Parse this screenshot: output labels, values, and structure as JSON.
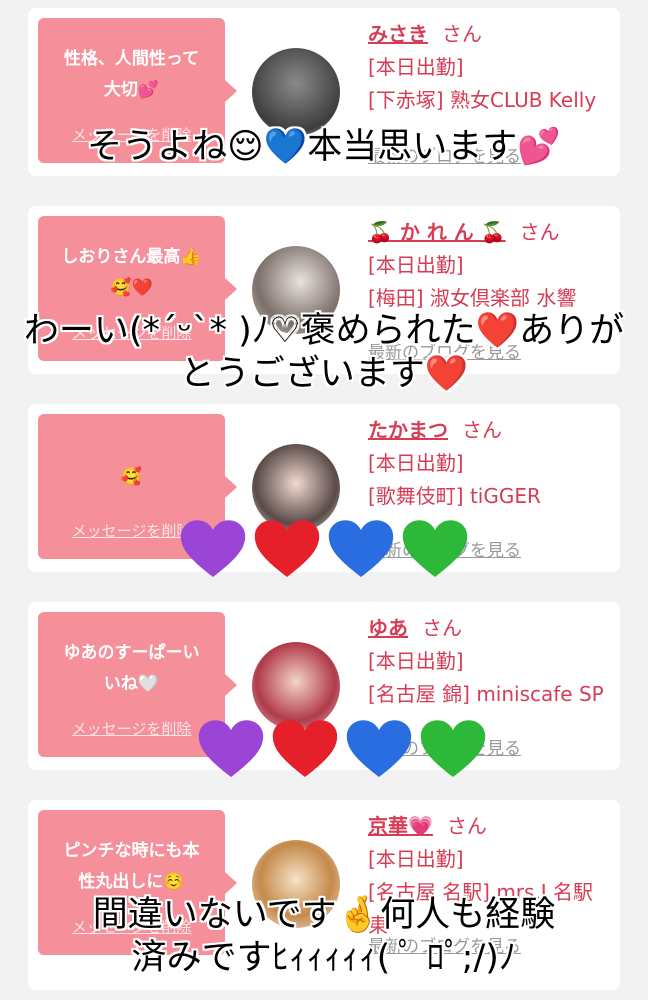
{
  "cards": [
    {
      "message": "性格、人間性って\n大切💕",
      "delete_label": "メッセージを削除",
      "name": "みさき",
      "san": "さん",
      "info": "[本日出勤]\n[下赤塚] 熟女CLUB Kelly",
      "blog_label": "最新のブログを見る"
    },
    {
      "message": "しおりさん最高👍\n🥰❤️",
      "delete_label": "メッセージを削除",
      "name": "🍒 か れ ん 🍒",
      "san": "さん",
      "info": "[本日出勤]\n[梅田] 淑女倶楽部 水響",
      "blog_label": "最新のブログを見る"
    },
    {
      "message": "🥰",
      "delete_label": "メッセージを削除",
      "name": "たかまつ",
      "san": "さん",
      "info": "[本日出勤]\n[歌舞伎町] tiGGER",
      "blog_label": "最新のブログを見る"
    },
    {
      "message": "ゆあのすーぱーい\nいね🤍",
      "delete_label": "メッセージを削除",
      "name": "ゆあ",
      "san": "さん",
      "info": "[本日出勤]\n[名古屋 錦] miniscafe SP",
      "blog_label": "最新のブログを見る"
    },
    {
      "message": "ピンチな時にも本\n性丸出しに☺️",
      "delete_label": "メッセージを削除",
      "name": "京華💗",
      "san": "さん",
      "info": "[本日出勤]\n[名古屋 名駅] mrs.J 名駅東",
      "blog_label": "最新のブログを見る"
    }
  ],
  "overlays": [
    "そうよね😌💙本当思います💕",
    "わーい(*ˊᵕˋ* )ﾉ♡褒められた❤️ありが\nとうございます❤️",
    "間違いないです🤞何人も経験\n済みですﾋｨｨｨｨｨ( ﾟ ﾛﾟ;/)ﾉ"
  ],
  "heart_colors": [
    "#9b45d6",
    "#e5202a",
    "#2a6de0",
    "#2db83a"
  ]
}
